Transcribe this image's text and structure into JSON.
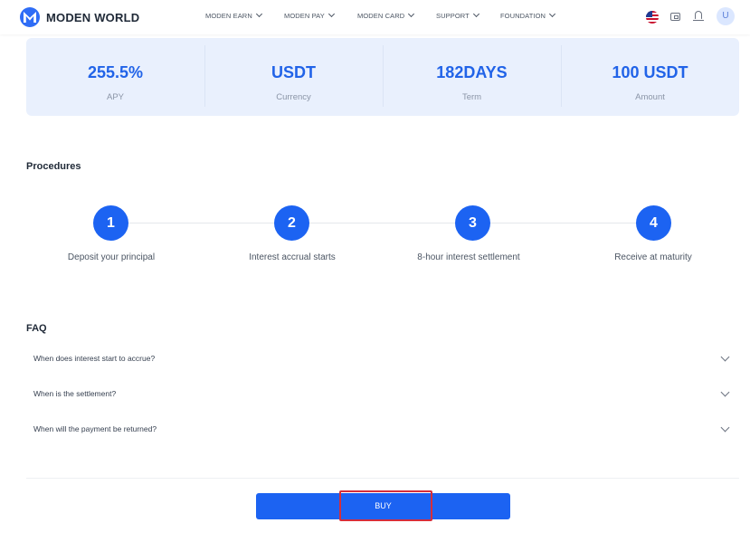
{
  "header": {
    "brand": "MODEN WORLD",
    "nav": [
      {
        "label": "MODEN EARN"
      },
      {
        "label": "MODEN PAY"
      },
      {
        "label": "MODEN CARD"
      },
      {
        "label": "SUPPORT"
      },
      {
        "label": "FOUNDATION"
      }
    ],
    "avatar_initial": "U",
    "icons": [
      "logo-icon",
      "us-flag-icon",
      "wallet-icon",
      "bell-icon"
    ]
  },
  "stats": [
    {
      "value": "255.5%",
      "label": "APY"
    },
    {
      "value": "USDT",
      "label": "Currency"
    },
    {
      "value": "182DAYS",
      "label": "Term"
    },
    {
      "value": "100 USDT",
      "label": "Amount"
    }
  ],
  "procedures": {
    "title": "Procedures",
    "steps": [
      {
        "number": "1",
        "label": "Deposit your principal"
      },
      {
        "number": "2",
        "label": "Interest accrual starts"
      },
      {
        "number": "3",
        "label": "8-hour interest settlement"
      },
      {
        "number": "4",
        "label": "Receive at maturity"
      }
    ]
  },
  "faq": {
    "title": "FAQ",
    "items": [
      {
        "question": "When does interest start to accrue?"
      },
      {
        "question": "When is the settlement?"
      },
      {
        "question": "When will the payment be returned?"
      }
    ]
  },
  "buy_button": {
    "label": "BUY"
  },
  "colors": {
    "accent": "#1c63f2",
    "highlight": "#d62e3a",
    "card_bg": "#e9f0fd"
  }
}
